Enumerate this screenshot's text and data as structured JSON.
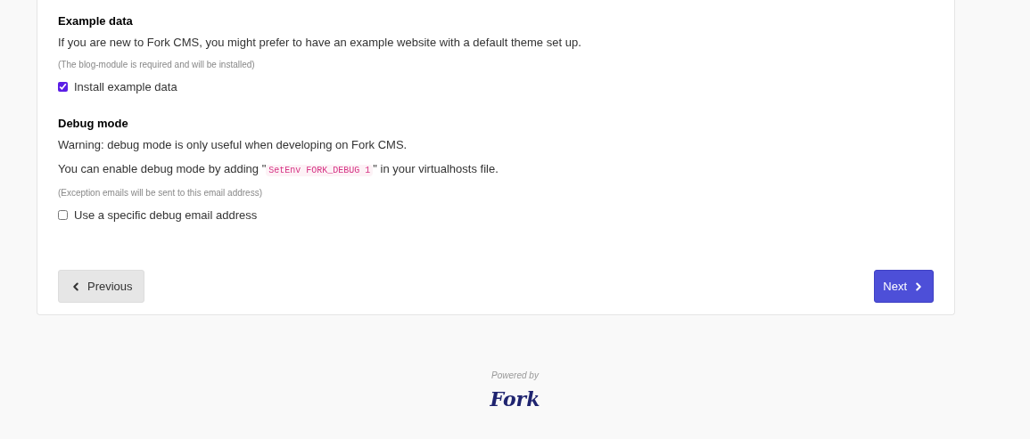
{
  "sections": [
    {
      "title": "Example data",
      "paragraphs": [
        {
          "kind": "text",
          "text": "If you are new to Fork CMS, you might prefer to have an example website with a default theme set up."
        }
      ],
      "hint": "(The blog-module is required and will be installed)",
      "checkbox": {
        "label": "Install example data",
        "checked": true
      }
    },
    {
      "title": "Debug mode",
      "paragraphs": [
        {
          "kind": "text",
          "text": "Warning: debug mode is only useful when developing on Fork CMS."
        },
        {
          "kind": "code",
          "before": "You can enable debug mode by adding \"",
          "code": "SetEnv FORK_DEBUG 1",
          "after": "\" in your virtualhosts file."
        }
      ],
      "hint": "(Exception emails will be sent to this email address)",
      "checkbox": {
        "label": "Use a specific debug email address",
        "checked": false
      }
    }
  ],
  "buttons": {
    "previous": "Previous",
    "next": "Next"
  },
  "footer": {
    "powered_by": "Powered by",
    "logo": "Fork"
  }
}
